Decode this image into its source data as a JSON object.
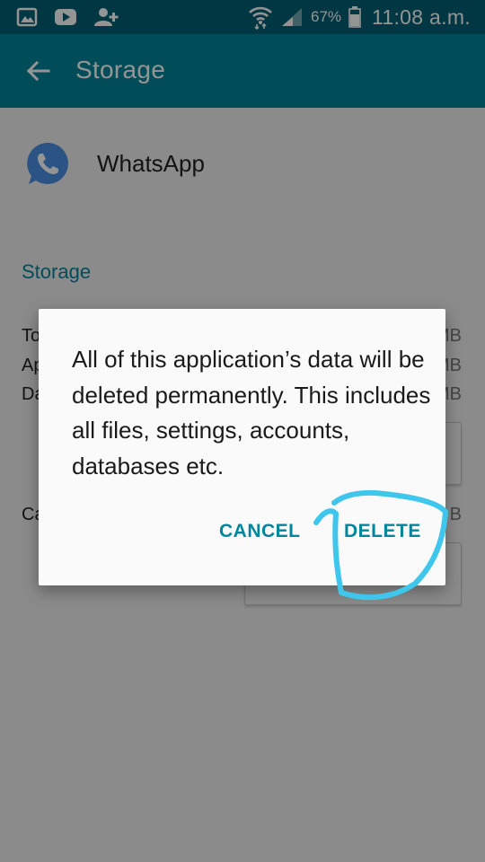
{
  "status_bar": {
    "battery_percent": "67%",
    "time": "11:08 a.m.",
    "icons": [
      "gallery-icon",
      "youtube-icon",
      "add-contact-icon",
      "wifi-icon",
      "signal-icon",
      "battery-icon"
    ]
  },
  "app_bar": {
    "title": "Storage",
    "back_icon": "arrow-back-icon"
  },
  "app": {
    "name": "WhatsApp",
    "icon": "whatsapp-icon"
  },
  "storage": {
    "section_title": "Storage",
    "rows_visible": [
      {
        "label": "To",
        "value": "MB"
      },
      {
        "label": "Ap",
        "value": "MB"
      },
      {
        "label": "Da",
        "value": "MB"
      }
    ],
    "cache": {
      "label": "Ca",
      "value": "B"
    }
  },
  "dialog": {
    "message": "All of this application’s data will be deleted permanently. This includes all files, settings, accounts, databases etc.",
    "cancel_label": "CANCEL",
    "delete_label": "DELETE"
  },
  "colors": {
    "status_bar": "#005f73",
    "app_bar": "#00869a",
    "accent": "#00869a",
    "annotation": "#3ec6ec"
  }
}
